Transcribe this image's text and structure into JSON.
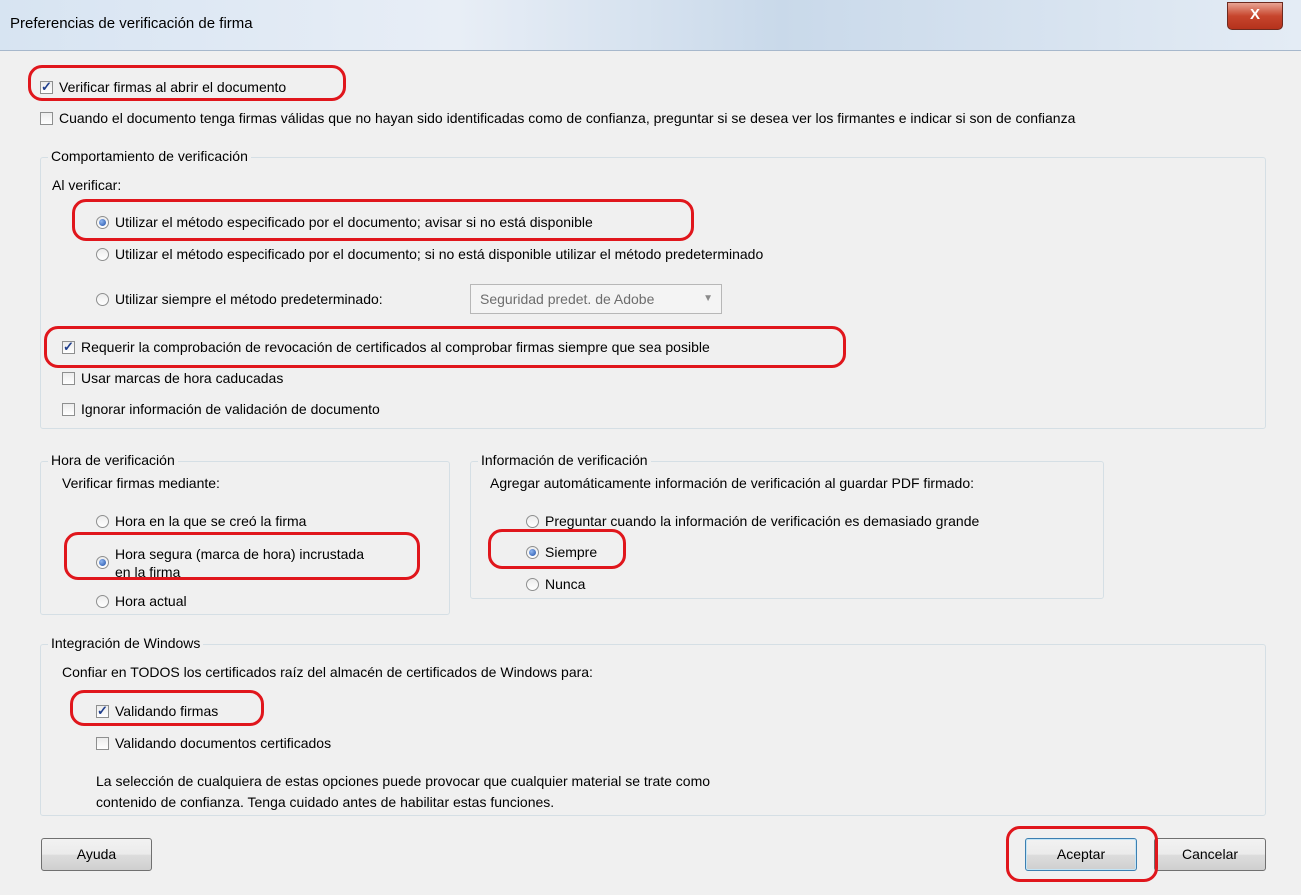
{
  "window": {
    "title": "Preferencias de verificación de firma",
    "close_label": "X"
  },
  "top": {
    "verify_on_open": {
      "label": "Verificar firmas al abrir el documento",
      "checked": true
    },
    "ask_signers": {
      "label": "Cuando el documento tenga firmas válidas que no hayan sido identificadas como de confianza, preguntar si se desea ver los firmantes e indicar si son de confianza",
      "checked": false
    }
  },
  "behavior": {
    "legend": "Comportamiento de verificación",
    "when_label": "Al verificar:",
    "method_opt1": "Utilizar el método especificado por el documento; avisar si no está disponible",
    "method_opt2": "Utilizar el método especificado por el documento; si no está disponible utilizar el método predeterminado",
    "method_opt3": "Utilizar siempre el método predeterminado:",
    "default_method": "Seguridad predet. de Adobe",
    "require_revocation": {
      "label": "Requerir la comprobación de revocación de certificados al comprobar firmas siempre que sea posible",
      "checked": true
    },
    "expired_timestamps": {
      "label": "Usar marcas de hora caducadas",
      "checked": false
    },
    "ignore_validation": {
      "label": "Ignorar información de validación de documento",
      "checked": false
    }
  },
  "verif_time": {
    "legend": "Hora de verificación",
    "sub": "Verificar firmas mediante:",
    "opt1": "Hora en la que se creó la firma",
    "opt2_line1": "Hora segura (marca de hora) incrustada",
    "opt2_line2": "en la firma",
    "opt3": "Hora actual"
  },
  "verif_info": {
    "legend": "Información de verificación",
    "sub": "Agregar automáticamente información de verificación al guardar PDF firmado:",
    "opt1": "Preguntar cuando la información de verificación es demasiado grande",
    "opt2": "Siempre",
    "opt3": "Nunca"
  },
  "windows": {
    "legend": "Integración de Windows",
    "sub": "Confiar en TODOS los certificados raíz del almacén de certificados de Windows para:",
    "validating_signatures": {
      "label": "Validando firmas",
      "checked": true
    },
    "validating_certified": {
      "label": "Validando documentos certificados",
      "checked": false
    },
    "note_line1": "La selección de cualquiera de estas opciones puede provocar que cualquier material se trate como",
    "note_line2": "contenido de confianza. Tenga cuidado antes de habilitar estas funciones."
  },
  "buttons": {
    "help": "Ayuda",
    "ok": "Aceptar",
    "cancel": "Cancelar"
  },
  "colors": {
    "highlight": "#e0161c",
    "radio_selected": "#1f4fa8",
    "check_mark": "#1f3e8c"
  }
}
